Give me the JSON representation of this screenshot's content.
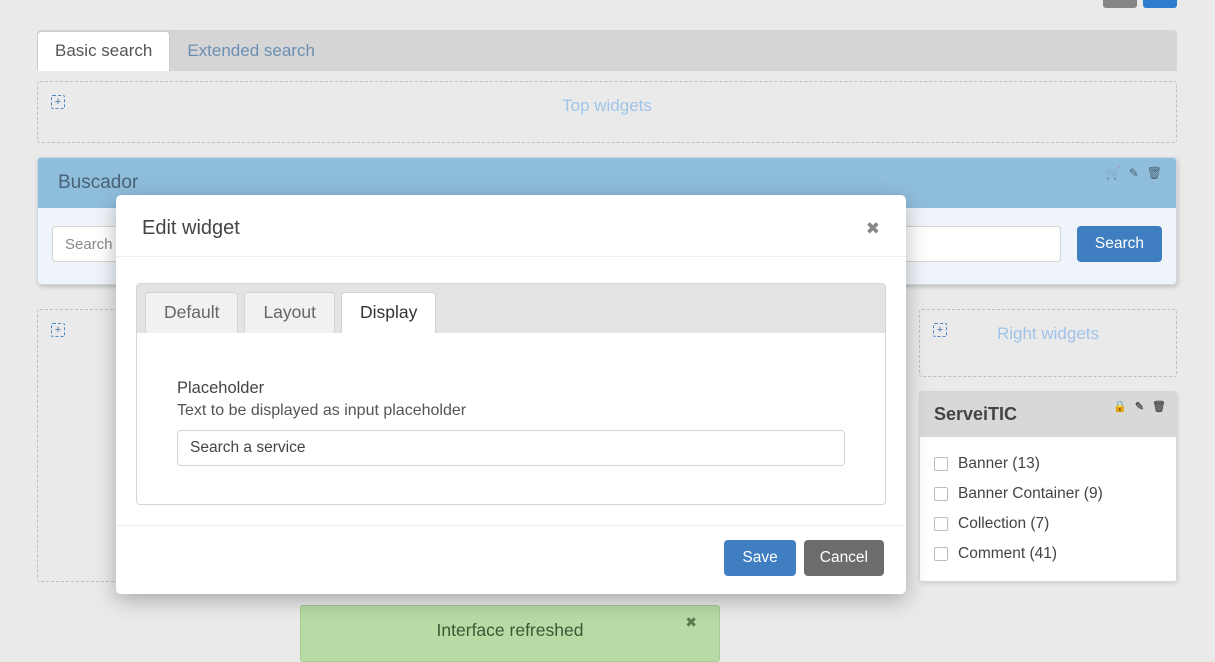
{
  "outer_tabs": {
    "basic": "Basic search",
    "extended": "Extended search"
  },
  "regions": {
    "top": "Top widgets",
    "left": "",
    "right": "Right widgets"
  },
  "buscador": {
    "title": "Buscador",
    "placeholder": "Search",
    "button": "Search"
  },
  "modal": {
    "title": "Edit widget",
    "tabs": {
      "default": "Default",
      "layout": "Layout",
      "display": "Display"
    },
    "field_label": "Placeholder",
    "field_help": "Text to be displayed as input placeholder",
    "field_value": "Search a service",
    "save": "Save",
    "cancel": "Cancel"
  },
  "side": {
    "title": "ServeiTIC",
    "items": [
      "Banner (13)",
      "Banner Container (9)",
      "Collection (7)",
      "Comment (41)"
    ]
  },
  "toast": "Interface refreshed"
}
